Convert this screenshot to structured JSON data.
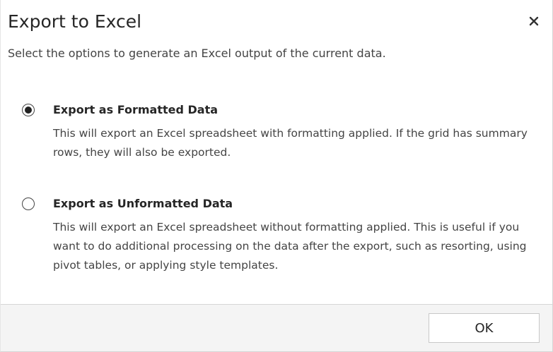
{
  "dialog": {
    "title": "Export to Excel",
    "subtitle": "Select the options to generate an Excel output of the current data.",
    "close_icon": "close-icon"
  },
  "options": [
    {
      "label": "Export as Formatted Data",
      "description": "This will export an Excel spreadsheet with formatting applied. If the grid has summary rows, they will also be exported.",
      "selected": true
    },
    {
      "label": "Export as Unformatted Data",
      "description": "This will export an Excel spreadsheet without formatting applied. This is useful if you want to do additional processing on the data after the export, such as resorting, using pivot tables, or applying style templates.",
      "selected": false
    }
  ],
  "footer": {
    "ok_label": "OK"
  }
}
